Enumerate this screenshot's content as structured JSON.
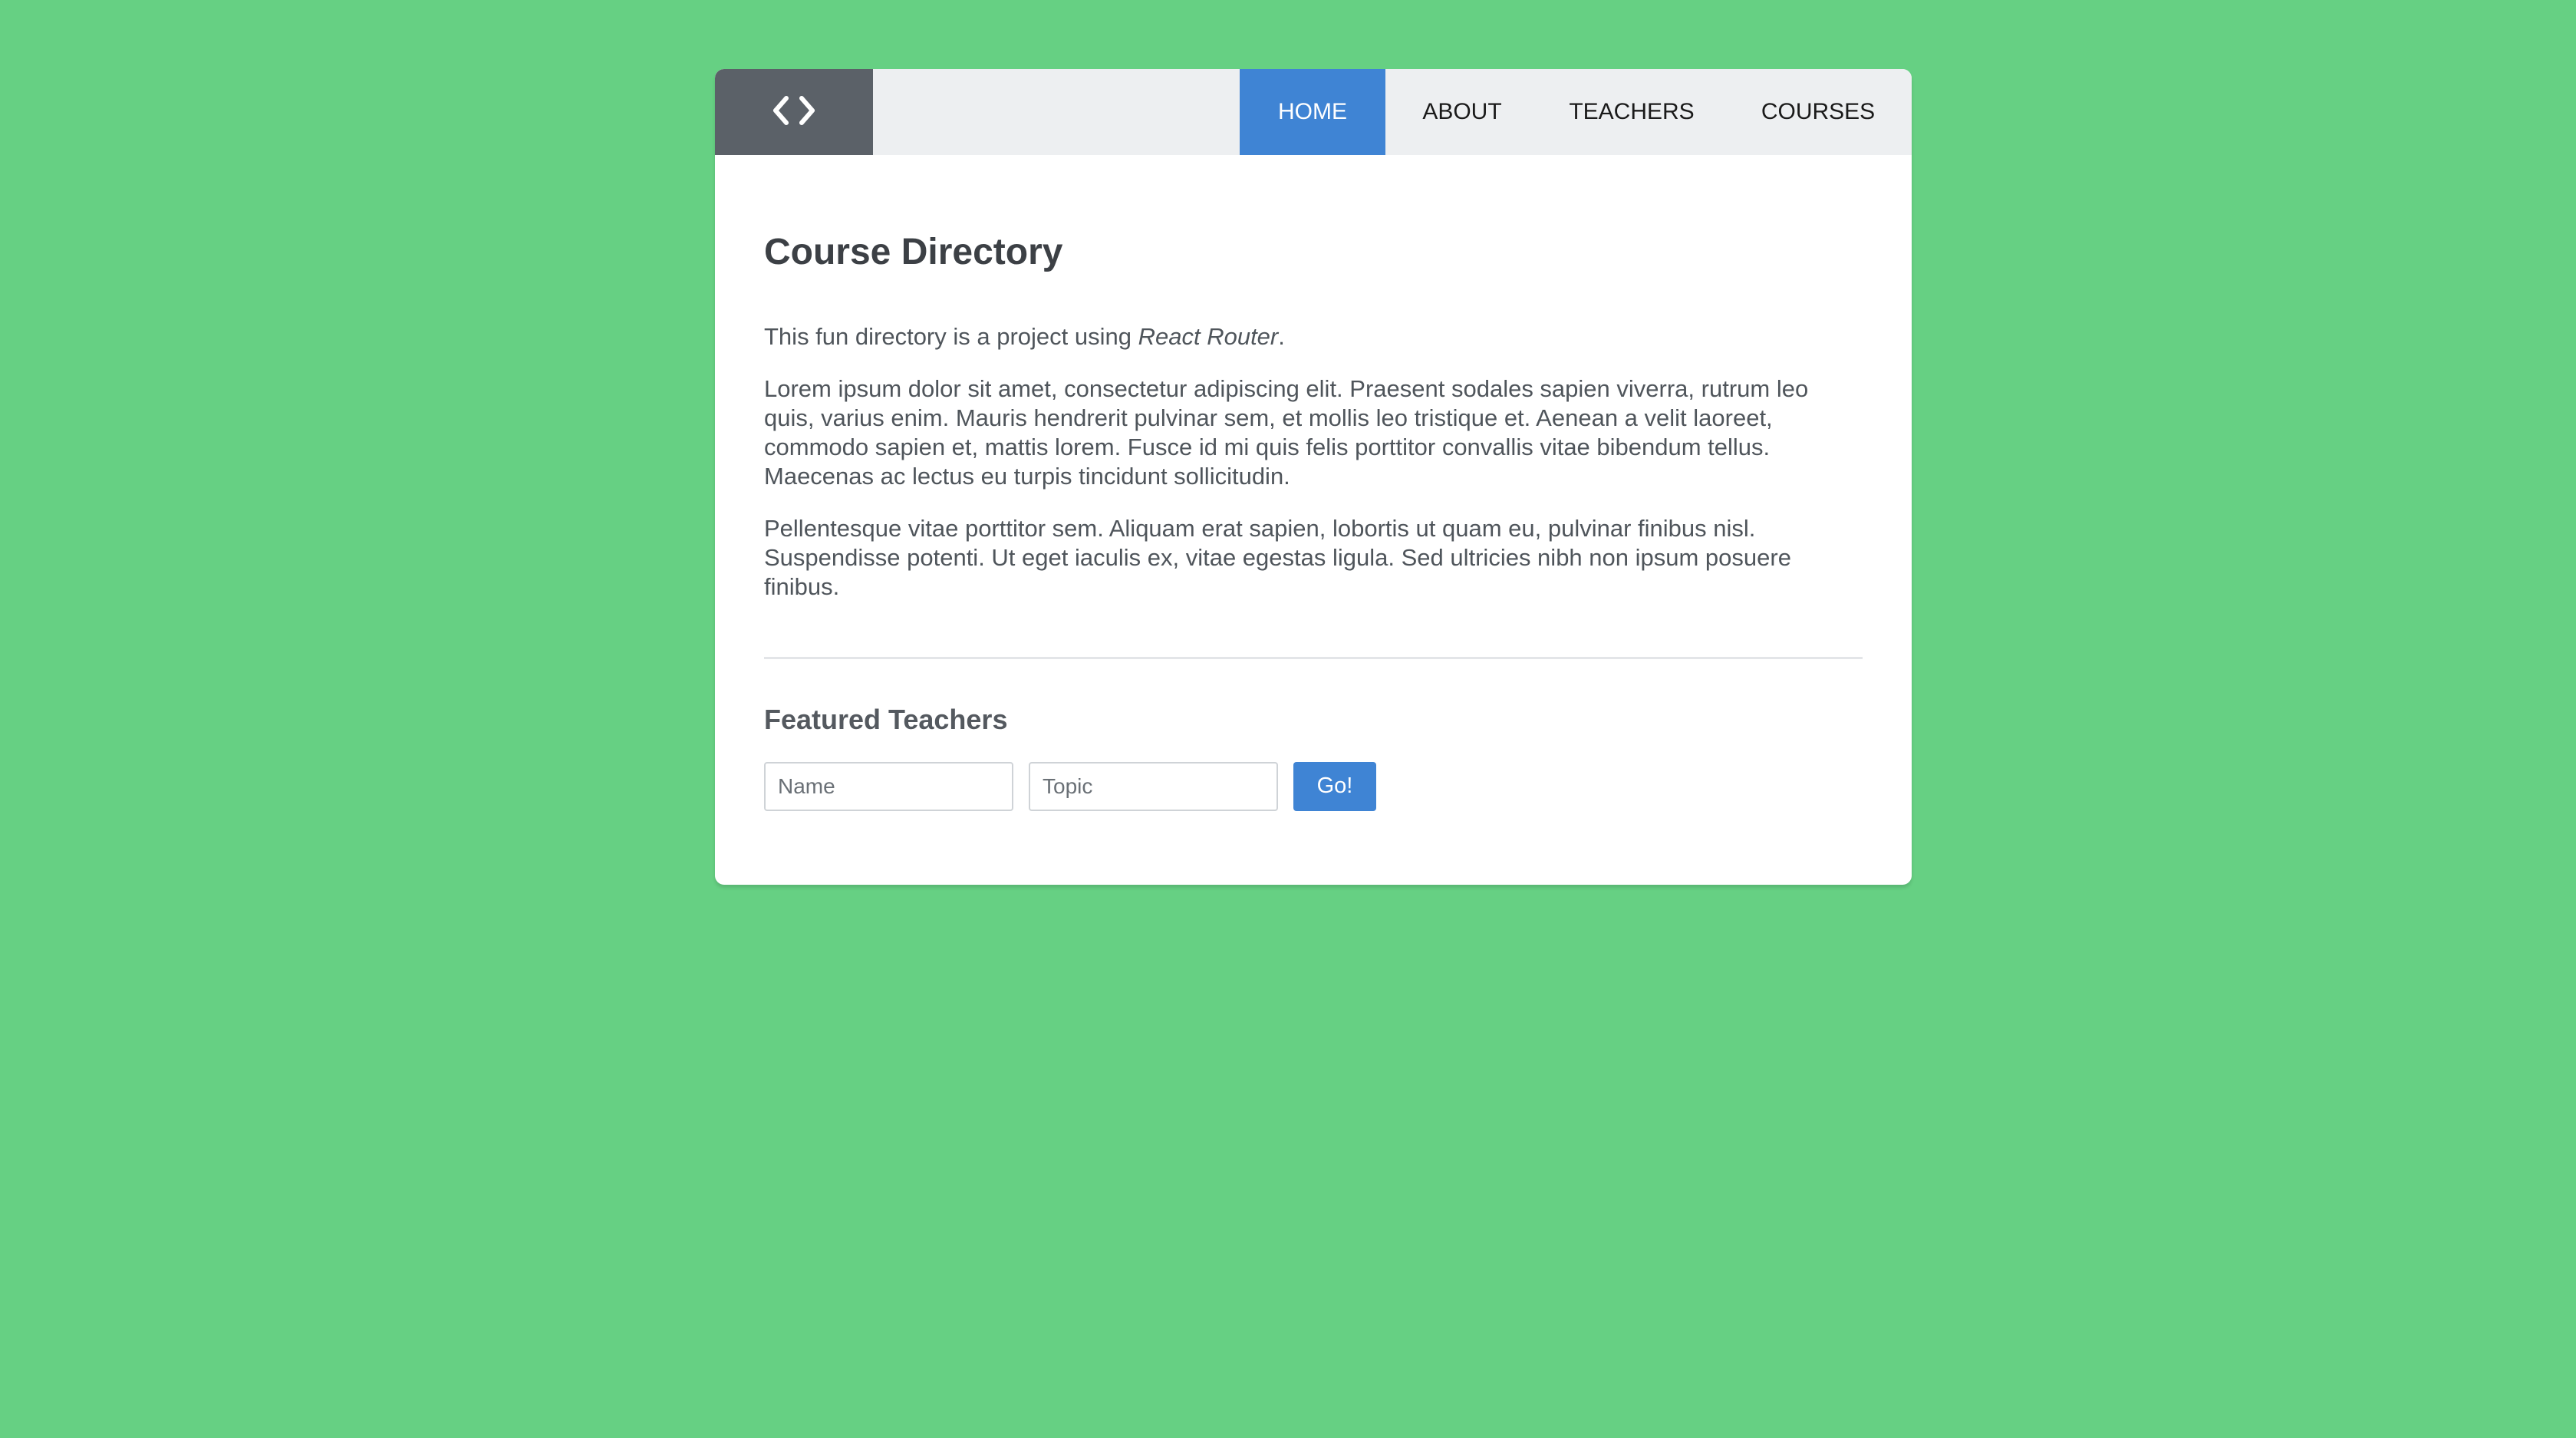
{
  "theme": {
    "background": "#66d083",
    "accent": "#3f84d4",
    "logo_bg": "#5b6168",
    "header_bg": "#edeff1"
  },
  "header": {
    "logo_icon": "code-brackets-icon",
    "nav": [
      {
        "label": "HOME",
        "active": true
      },
      {
        "label": "ABOUT",
        "active": false
      },
      {
        "label": "TEACHERS",
        "active": false
      },
      {
        "label": "COURSES",
        "active": false
      }
    ]
  },
  "main": {
    "title": "Course Directory",
    "intro_prefix": "This fun directory is a project using ",
    "intro_emphasis": "React Router",
    "intro_suffix": ".",
    "paragraphs": [
      "Lorem ipsum dolor sit amet, consectetur adipiscing elit. Praesent sodales sapien viverra, rutrum leo quis, varius enim. Mauris hendrerit pulvinar sem, et mollis leo tristique et. Aenean a velit laoreet, commodo sapien et, mattis lorem. Fusce id mi quis felis porttitor convallis vitae bibendum tellus. Maecenas ac lectus eu turpis tincidunt sollicitudin.",
      "Pellentesque vitae porttitor sem. Aliquam erat sapien, lobortis ut quam eu, pulvinar finibus nisl. Suspendisse potenti. Ut eget iaculis ex, vitae egestas ligula. Sed ultricies nibh non ipsum posuere finibus."
    ],
    "featured": {
      "title": "Featured Teachers",
      "name_placeholder": "Name",
      "name_value": "",
      "topic_placeholder": "Topic",
      "topic_value": "",
      "submit_label": "Go!"
    }
  }
}
